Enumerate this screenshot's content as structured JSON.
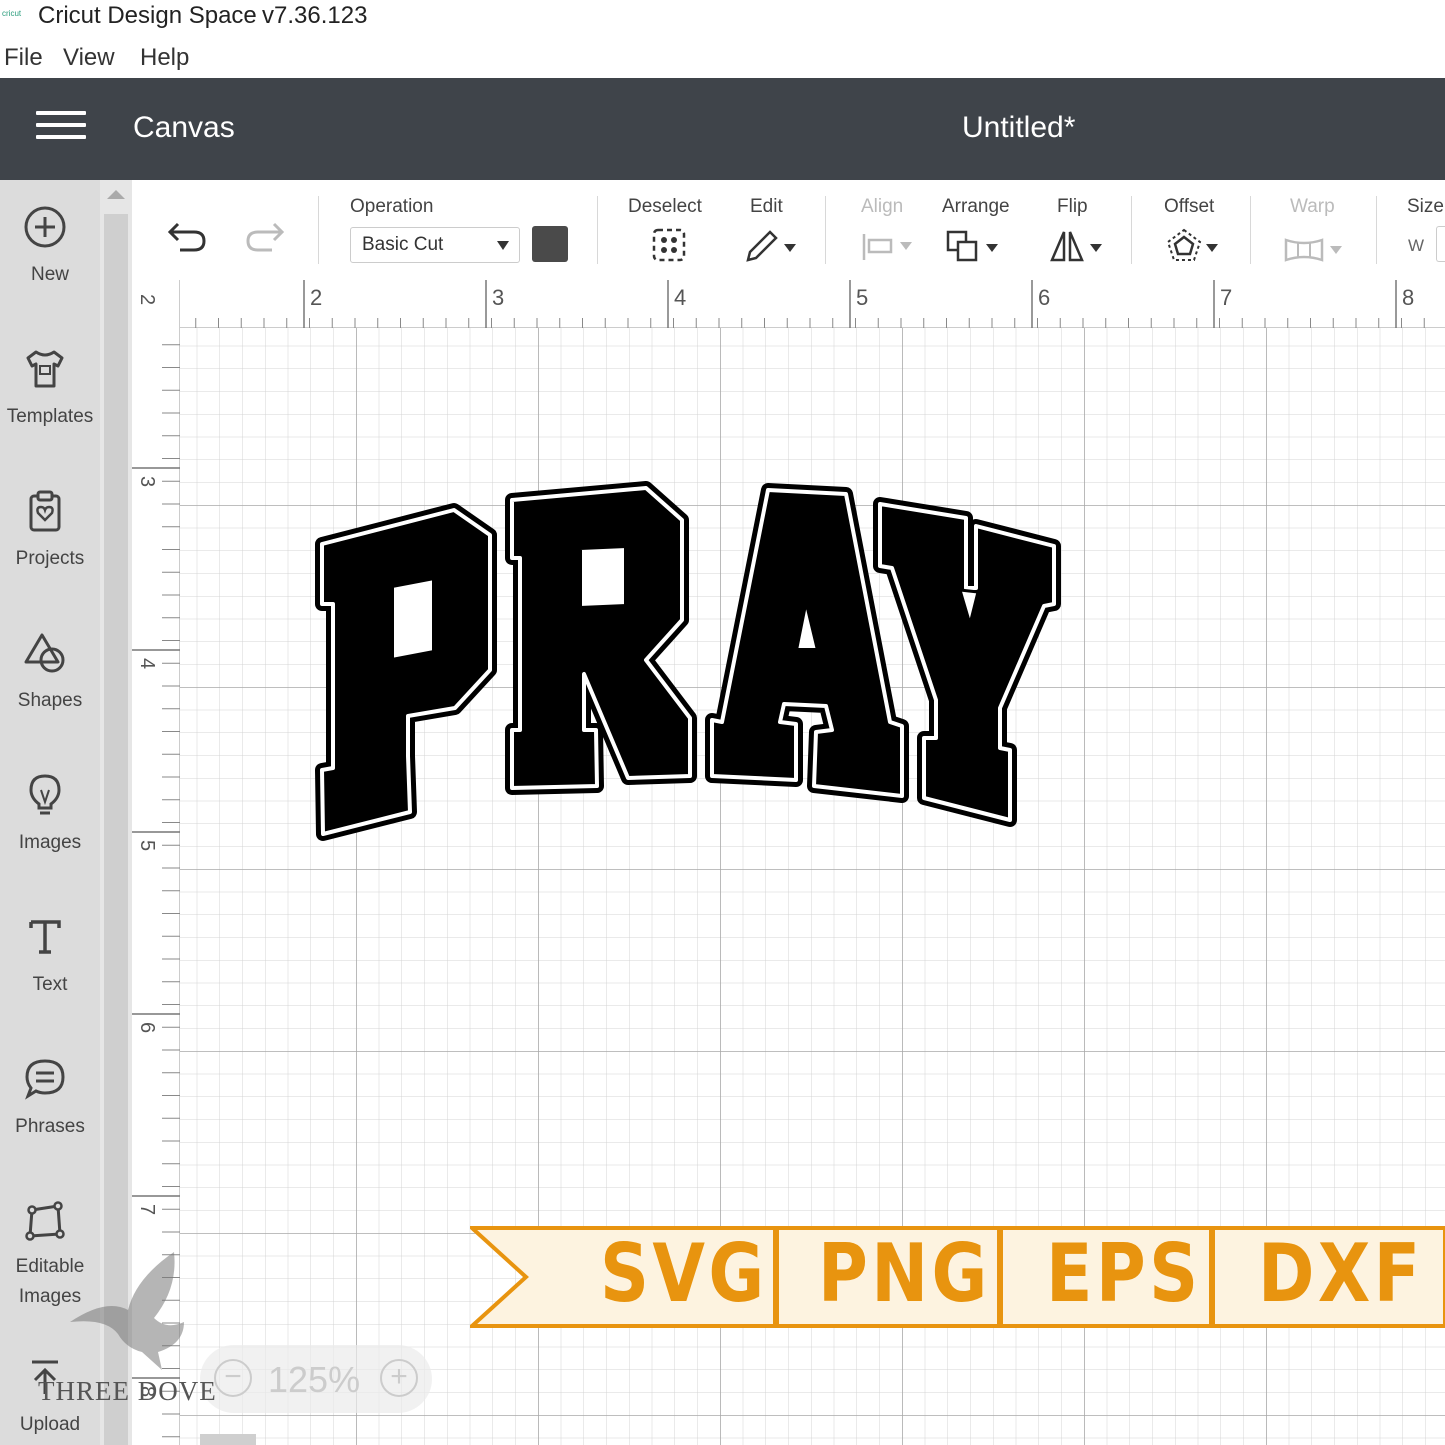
{
  "app": {
    "title": "Cricut Design Space",
    "version": "v7.36.123"
  },
  "menu": [
    "File",
    "View",
    "Help"
  ],
  "header": {
    "section": "Canvas",
    "document_title": "Untitled*"
  },
  "sidebar": {
    "items": [
      {
        "label": "New",
        "icon": "plus-circle-icon"
      },
      {
        "label": "Templates",
        "icon": "tshirt-icon"
      },
      {
        "label": "Projects",
        "icon": "clipboard-heart-icon"
      },
      {
        "label": "Shapes",
        "icon": "shapes-icon"
      },
      {
        "label": "Images",
        "icon": "lightbulb-icon"
      },
      {
        "label": "Text",
        "icon": "text-t-icon"
      },
      {
        "label": "Phrases",
        "icon": "speech-bubble-icon"
      },
      {
        "label": "Editable",
        "label2": "Images",
        "icon": "editable-image-icon"
      },
      {
        "label": "Upload",
        "icon": "upload-icon"
      }
    ]
  },
  "toolbar": {
    "operation_label": "Operation",
    "operation_value": "Basic Cut",
    "operation_color": "#4a4a4a",
    "deselect_label": "Deselect",
    "edit_label": "Edit",
    "align_label": "Align",
    "arrange_label": "Arrange",
    "flip_label": "Flip",
    "offset_label": "Offset",
    "warp_label": "Warp",
    "size_label": "Size",
    "size_w": "W"
  },
  "ruler": {
    "top": [
      "2",
      "3",
      "4",
      "5",
      "6",
      "7",
      "8"
    ],
    "left": [
      "2",
      "3",
      "4",
      "5",
      "6",
      "7",
      "8"
    ]
  },
  "design": {
    "text": "PRAY",
    "fill": "#000000",
    "outline": "#ffffff"
  },
  "banner": {
    "formats": [
      "SVG",
      "PNG",
      "EPS",
      "DXF"
    ],
    "text_color": "#e8940f",
    "background": "#fdf3e0"
  },
  "zoom": {
    "value": "125%",
    "minus": "−",
    "plus": "+"
  },
  "watermark": {
    "text": "THREE DOVE"
  }
}
